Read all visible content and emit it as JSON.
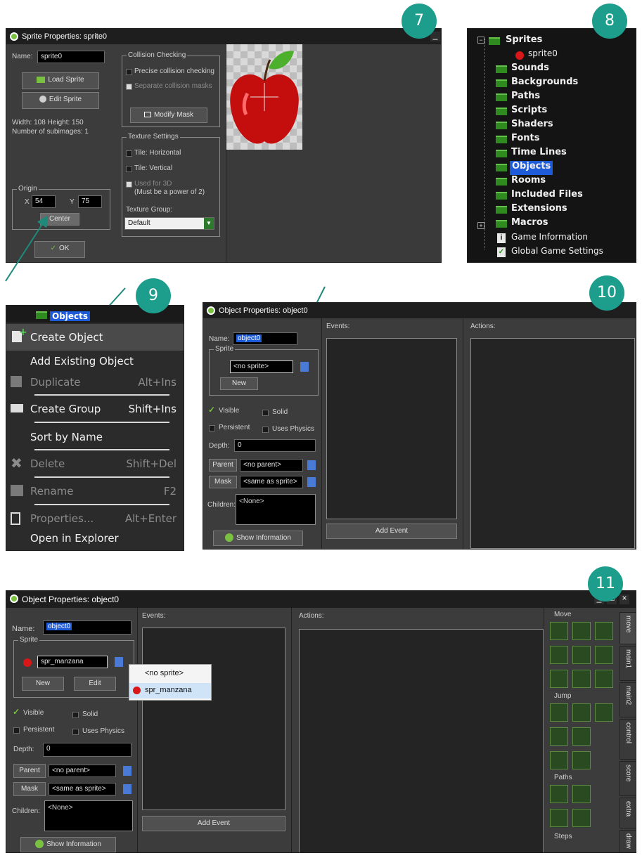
{
  "badges": [
    "7",
    "8",
    "9",
    "10",
    "11"
  ],
  "sprite_props": {
    "title": "Sprite Properties: sprite0",
    "name_label": "Name:",
    "name_value": "sprite0",
    "load_sprite": "Load Sprite",
    "edit_sprite": "Edit Sprite",
    "size_text": "Width: 108   Height: 150",
    "subimages_text": "Number of subimages: 1",
    "origin_label": "Origin",
    "x_label": "X",
    "x_value": "54",
    "y_label": "Y",
    "y_value": "75",
    "center_btn": "Center",
    "ok_btn": "OK",
    "collision_label": "Collision Checking",
    "precise": "Precise collision checking",
    "separate": "Separate collision masks",
    "modify_mask": "Modify Mask",
    "texture_label": "Texture Settings",
    "tile_h": "Tile: Horizontal",
    "tile_v": "Tile: Vertical",
    "used_3d": "Used for 3D",
    "power2": "(Must be a power of 2)",
    "texture_group_label": "Texture Group:",
    "texture_group_value": "Default"
  },
  "resource_tree": {
    "items": [
      "Sprites",
      "sprite0",
      "Sounds",
      "Backgrounds",
      "Paths",
      "Scripts",
      "Shaders",
      "Fonts",
      "Time Lines",
      "Objects",
      "Rooms",
      "Included Files",
      "Extensions",
      "Macros",
      "Game Information",
      "Global Game Settings"
    ],
    "selected": "Objects"
  },
  "context_menu": {
    "header": "Objects",
    "items": [
      {
        "label": "Create Object",
        "shortcut": ""
      },
      {
        "label": "Add Existing Object",
        "shortcut": ""
      },
      {
        "label": "Duplicate",
        "shortcut": "Alt+Ins"
      },
      {
        "label": "Create Group",
        "shortcut": "Shift+Ins"
      },
      {
        "label": "Sort by Name",
        "shortcut": ""
      },
      {
        "label": "Delete",
        "shortcut": "Shift+Del"
      },
      {
        "label": "Rename",
        "shortcut": "F2"
      },
      {
        "label": "Properties...",
        "shortcut": "Alt+Enter"
      },
      {
        "label": "Open in Explorer",
        "shortcut": ""
      }
    ]
  },
  "object_props_small": {
    "title": "Object Properties: object0",
    "name_label": "Name:",
    "name_value": "object0",
    "sprite_label": "Sprite",
    "sprite_value": "<no sprite>",
    "new_btn": "New",
    "visible": "Visible",
    "solid": "Solid",
    "persistent": "Persistent",
    "uses_physics": "Uses Physics",
    "depth_label": "Depth:",
    "depth_value": "0",
    "parent_btn": "Parent",
    "parent_value": "<no parent>",
    "mask_btn": "Mask",
    "mask_value": "<same as sprite>",
    "children_label": "Children:",
    "children_value": "<None>",
    "show_info": "Show Information",
    "events_label": "Events:",
    "actions_label": "Actions:",
    "add_event": "Add Event"
  },
  "object_props_large": {
    "title": "Object Properties: object0",
    "name_label": "Name:",
    "name_value": "object0",
    "sprite_label": "Sprite",
    "sprite_value": "spr_manzana",
    "new_btn": "New",
    "edit_btn": "Edit",
    "visible": "Visible",
    "solid": "Solid",
    "persistent": "Persistent",
    "uses_physics": "Uses Physics",
    "depth_label": "Depth:",
    "depth_value": "0",
    "parent_btn": "Parent",
    "parent_value": "<no parent>",
    "mask_btn": "Mask",
    "mask_value": "<same as sprite>",
    "children_label": "Children:",
    "children_value": "<None>",
    "show_info": "Show Information",
    "events_label": "Events:",
    "actions_label": "Actions:",
    "add_event": "Add Event",
    "dropdown": [
      "<no sprite>",
      "spr_manzana"
    ],
    "tool_groups": [
      "Move",
      "Jump",
      "Paths",
      "Steps"
    ],
    "side_tabs": [
      "move",
      "main1",
      "main2",
      "control",
      "score",
      "extra",
      "draw"
    ]
  },
  "colors": {
    "badge": "#1d9e8c",
    "arrow": "#1d8a7a",
    "highlight": "#1e5bd8",
    "accent_green": "#7ac142"
  }
}
